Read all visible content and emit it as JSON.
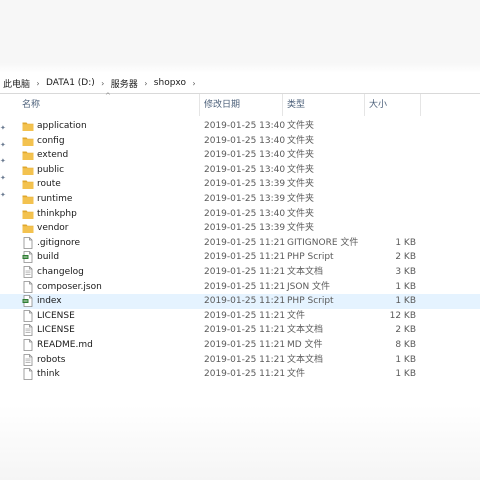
{
  "breadcrumb": {
    "items": [
      {
        "label": "此电脑"
      },
      {
        "label": "DATA1 (D:)"
      },
      {
        "label": "服务器"
      },
      {
        "label": "shopxo"
      }
    ],
    "separator": "›"
  },
  "columns": {
    "name": "名称",
    "date": "修改日期",
    "type": "类型",
    "size": "大小",
    "sort_indicator": "^"
  },
  "files": [
    {
      "name": "application",
      "date": "2019-01-25 13:40",
      "type": "文件夹",
      "size": "",
      "icon": "folder-icon"
    },
    {
      "name": "config",
      "date": "2019-01-25 13:40",
      "type": "文件夹",
      "size": "",
      "icon": "folder-icon"
    },
    {
      "name": "extend",
      "date": "2019-01-25 13:40",
      "type": "文件夹",
      "size": "",
      "icon": "folder-icon"
    },
    {
      "name": "public",
      "date": "2019-01-25 13:40",
      "type": "文件夹",
      "size": "",
      "icon": "folder-icon"
    },
    {
      "name": "route",
      "date": "2019-01-25 13:39",
      "type": "文件夹",
      "size": "",
      "icon": "folder-icon"
    },
    {
      "name": "runtime",
      "date": "2019-01-25 13:39",
      "type": "文件夹",
      "size": "",
      "icon": "folder-icon"
    },
    {
      "name": "thinkphp",
      "date": "2019-01-25 13:40",
      "type": "文件夹",
      "size": "",
      "icon": "folder-icon"
    },
    {
      "name": "vendor",
      "date": "2019-01-25 13:39",
      "type": "文件夹",
      "size": "",
      "icon": "folder-icon"
    },
    {
      "name": ".gitignore",
      "date": "2019-01-25 11:21",
      "type": "GITIGNORE 文件",
      "size": "1 KB",
      "icon": "file-icon"
    },
    {
      "name": "build",
      "date": "2019-01-25 11:21",
      "type": "PHP Script",
      "size": "2 KB",
      "icon": "php-script-icon"
    },
    {
      "name": "changelog",
      "date": "2019-01-25 11:21",
      "type": "文本文档",
      "size": "3 KB",
      "icon": "text-document-icon"
    },
    {
      "name": "composer.json",
      "date": "2019-01-25 11:21",
      "type": "JSON 文件",
      "size": "1 KB",
      "icon": "file-icon"
    },
    {
      "name": "index",
      "date": "2019-01-25 11:21",
      "type": "PHP Script",
      "size": "1 KB",
      "icon": "php-script-icon",
      "selected": true
    },
    {
      "name": "LICENSE",
      "date": "2019-01-25 11:21",
      "type": "文件",
      "size": "12 KB",
      "icon": "file-icon"
    },
    {
      "name": "LICENSE",
      "date": "2019-01-25 11:21",
      "type": "文本文档",
      "size": "2 KB",
      "icon": "text-document-icon"
    },
    {
      "name": "README.md",
      "date": "2019-01-25 11:21",
      "type": "MD 文件",
      "size": "8 KB",
      "icon": "file-icon"
    },
    {
      "name": "robots",
      "date": "2019-01-25 11:21",
      "type": "文本文档",
      "size": "1 KB",
      "icon": "text-document-icon"
    },
    {
      "name": "think",
      "date": "2019-01-25 11:21",
      "type": "文件",
      "size": "1 KB",
      "icon": "file-icon"
    }
  ],
  "colors": {
    "folder": "#f3c24f",
    "folder_dark": "#e0a82e",
    "selected_row": "#e5f3ff",
    "header_text": "#4c607a",
    "php_green": "#2e7d32"
  }
}
